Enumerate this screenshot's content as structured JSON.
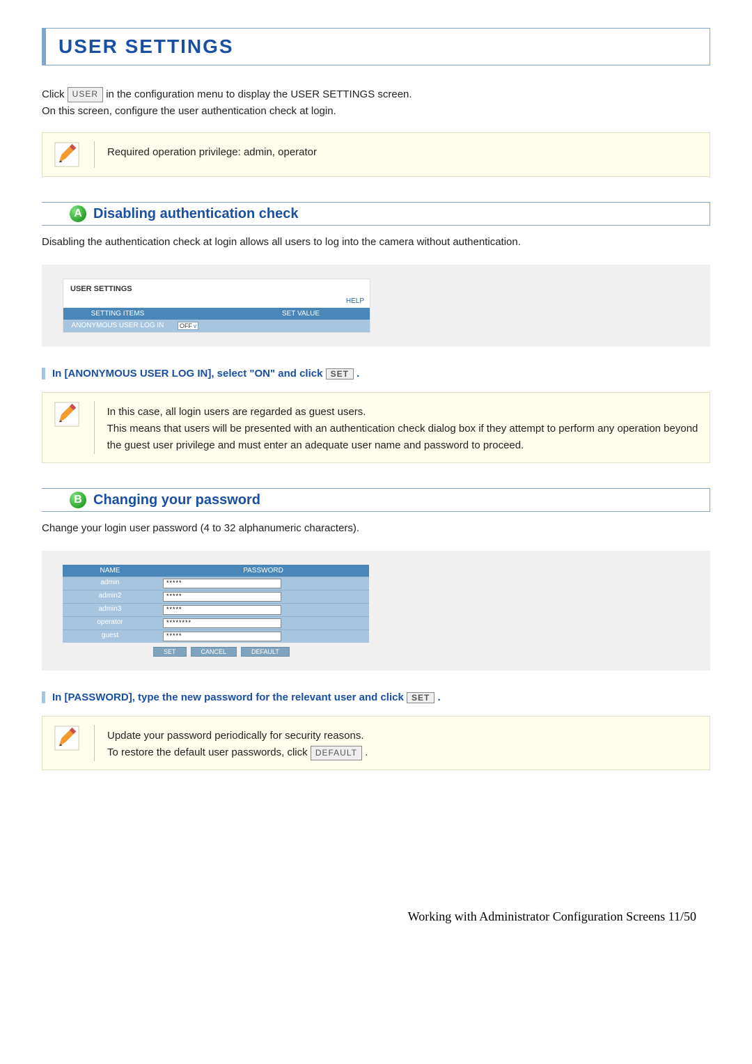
{
  "title": "USER SETTINGS",
  "intro": {
    "prefix": "Click",
    "btn": "USER",
    "suffix": "in the configuration menu to display the USER SETTINGS screen.",
    "line2": "On this screen, configure the user authentication check at login."
  },
  "note_privilege": "Required operation privilege: admin, operator",
  "section_a": {
    "letter": "A",
    "title": "Disabling authentication check",
    "desc": "Disabling the authentication check at login allows all users to log into the camera without authentication.",
    "panel": {
      "title": "USER SETTINGS",
      "help": "HELP",
      "head_setting": "SETTING ITEMS",
      "head_value": "SET VALUE",
      "row_label": "ANONYMOUS USER LOG IN",
      "row_value": "OFF"
    },
    "instruction": {
      "prefix": "In [ANONYMOUS USER LOG IN], select \"ON\" and click",
      "btn": "SET",
      "suffix": "."
    },
    "note": {
      "line1": "In this case, all login users are regarded as guest users.",
      "line2": "This means that users will be presented with an authentication check dialog box if they attempt to perform any operation beyond the guest user privilege and must enter an adequate user name and password to proceed."
    }
  },
  "section_b": {
    "letter": "B",
    "title": "Changing your password",
    "desc": "Change your login user password (4 to 32 alphanumeric characters).",
    "panel": {
      "head_name": "NAME",
      "head_pwd": "PASSWORD",
      "rows": [
        {
          "name": "admin",
          "pwd": "*****"
        },
        {
          "name": "admin2",
          "pwd": "*****"
        },
        {
          "name": "admin3",
          "pwd": "*****"
        },
        {
          "name": "operator",
          "pwd": "********"
        },
        {
          "name": "guest",
          "pwd": "*****"
        }
      ],
      "btn_set": "SET",
      "btn_cancel": "CANCEL",
      "btn_default": "DEFAULT"
    },
    "instruction": {
      "prefix": "In [PASSWORD], type the new password for the relevant user and click",
      "btn": "SET",
      "suffix": "."
    },
    "note": {
      "line1": "Update your password periodically for security reasons.",
      "line2_prefix": "To restore the default user passwords, click",
      "line2_btn": "DEFAULT",
      "line2_suffix": "."
    }
  },
  "footer": "Working with Administrator Configuration Screens 11/50"
}
